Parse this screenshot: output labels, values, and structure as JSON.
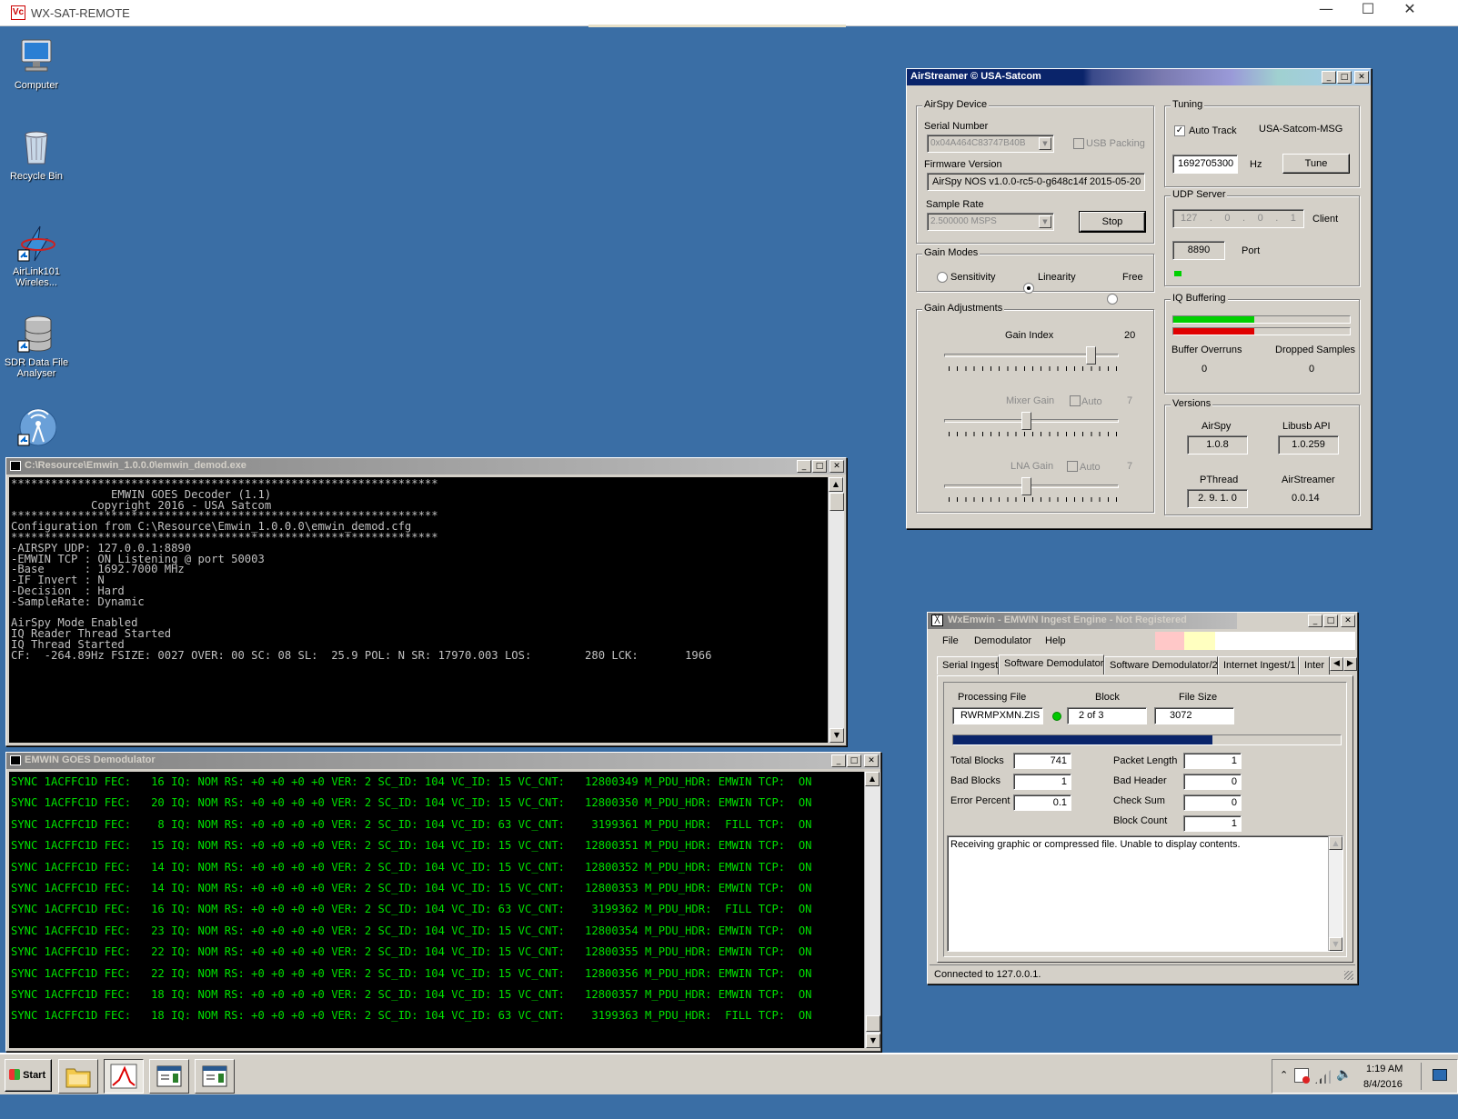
{
  "outer_window": {
    "title": "WX-SAT-REMOTE",
    "icon_text": "Vc"
  },
  "desktop_icons": [
    {
      "label": "Computer"
    },
    {
      "label": "Recycle Bin"
    },
    {
      "label": "AirLink101 Wireles..."
    },
    {
      "label": "SDR Data File Analyser"
    }
  ],
  "emwin_decoder": {
    "title": "C:\\Resource\\Emwin_1.0.0.0\\emwin_demod.exe",
    "lines": [
      "****************************************************************",
      "               EMWIN GOES Decoder (1.1)",
      "            Copyright 2016 - USA Satcom",
      "****************************************************************",
      "Configuration from C:\\Resource\\Emwin_1.0.0.0\\emwin_demod.cfg",
      "****************************************************************",
      "-AIRSPY UDP: 127.0.0.1:8890",
      "-EMWIN TCP : ON Listening @ port 50003",
      "-Base      : 1692.7000 MHz",
      "-IF Invert : N",
      "-Decision  : Hard",
      "-SampleRate: Dynamic",
      "",
      "AirSpy Mode Enabled",
      "IQ Reader Thread Started",
      "IQ Thread Started",
      "CF:  -264.89Hz FSIZE: 0027 OVER: 00 SC: 08 SL:  25.9 POL: N SR: 17970.003 LOS:        280 LCK:       1966"
    ]
  },
  "goes_demod": {
    "title": "EMWIN GOES Demodulator",
    "lines": [
      "SYNC 1ACFFC1D FEC:   16 IQ: NOM RS: +0 +0 +0 +0 VER: 2 SC_ID: 104 VC_ID: 15 VC_CNT:   12800349 M_PDU_HDR: EMWIN TCP:  ON",
      "SYNC 1ACFFC1D FEC:   20 IQ: NOM RS: +0 +0 +0 +0 VER: 2 SC_ID: 104 VC_ID: 15 VC_CNT:   12800350 M_PDU_HDR: EMWIN TCP:  ON",
      "SYNC 1ACFFC1D FEC:    8 IQ: NOM RS: +0 +0 +0 +0 VER: 2 SC_ID: 104 VC_ID: 63 VC_CNT:    3199361 M_PDU_HDR:  FILL TCP:  ON",
      "SYNC 1ACFFC1D FEC:   15 IQ: NOM RS: +0 +0 +0 +0 VER: 2 SC_ID: 104 VC_ID: 15 VC_CNT:   12800351 M_PDU_HDR: EMWIN TCP:  ON",
      "SYNC 1ACFFC1D FEC:   14 IQ: NOM RS: +0 +0 +0 +0 VER: 2 SC_ID: 104 VC_ID: 15 VC_CNT:   12800352 M_PDU_HDR: EMWIN TCP:  ON",
      "SYNC 1ACFFC1D FEC:   14 IQ: NOM RS: +0 +0 +0 +0 VER: 2 SC_ID: 104 VC_ID: 15 VC_CNT:   12800353 M_PDU_HDR: EMWIN TCP:  ON",
      "SYNC 1ACFFC1D FEC:   16 IQ: NOM RS: +0 +0 +0 +0 VER: 2 SC_ID: 104 VC_ID: 63 VC_CNT:    3199362 M_PDU_HDR:  FILL TCP:  ON",
      "SYNC 1ACFFC1D FEC:   23 IQ: NOM RS: +0 +0 +0 +0 VER: 2 SC_ID: 104 VC_ID: 15 VC_CNT:   12800354 M_PDU_HDR: EMWIN TCP:  ON",
      "SYNC 1ACFFC1D FEC:   22 IQ: NOM RS: +0 +0 +0 +0 VER: 2 SC_ID: 104 VC_ID: 15 VC_CNT:   12800355 M_PDU_HDR: EMWIN TCP:  ON",
      "SYNC 1ACFFC1D FEC:   22 IQ: NOM RS: +0 +0 +0 +0 VER: 2 SC_ID: 104 VC_ID: 15 VC_CNT:   12800356 M_PDU_HDR: EMWIN TCP:  ON",
      "SYNC 1ACFFC1D FEC:   18 IQ: NOM RS: +0 +0 +0 +0 VER: 2 SC_ID: 104 VC_ID: 15 VC_CNT:   12800357 M_PDU_HDR: EMWIN TCP:  ON",
      "SYNC 1ACFFC1D FEC:   18 IQ: NOM RS: +0 +0 +0 +0 VER: 2 SC_ID: 104 VC_ID: 63 VC_CNT:    3199363 M_PDU_HDR:  FILL TCP:  ON"
    ]
  },
  "airstreamer": {
    "title": "AirStreamer © USA-Satcom",
    "device": {
      "group": "AirSpy Device",
      "serial_label": "Serial Number",
      "serial_value": "0x04A464C83747B40B",
      "usb_packing": "USB Packing",
      "firmware_label": "Firmware Version",
      "firmware_value": "AirSpy NOS v1.0.0-rc5-0-g648c14f 2015-05-20",
      "sample_rate_label": "Sample Rate",
      "sample_rate_value": "2.500000 MSPS",
      "stop_button": "Stop"
    },
    "gain_modes": {
      "group": "Gain Modes",
      "options": [
        "Sensitivity",
        "Linearity",
        "Free"
      ],
      "selected": "Linearity"
    },
    "gain_adj": {
      "group": "Gain Adjustments",
      "gain_index_label": "Gain Index",
      "gain_index_value": "20",
      "mixer_label": "Mixer Gain",
      "mixer_value": "7",
      "lna_label": "LNA Gain",
      "lna_value": "7",
      "auto_label": "Auto",
      "gain_index_level": 0.86,
      "mixer_level": 0.47,
      "lna_level": 0.47
    },
    "tuning": {
      "group": "Tuning",
      "auto_track": "Auto Track",
      "preset": "USA-Satcom-MSG",
      "frequency": "1692705300",
      "unit": "Hz",
      "tune_button": "Tune"
    },
    "udp": {
      "group": "UDP Server",
      "ip_octets": [
        "127",
        "0",
        "0",
        "1"
      ],
      "client_label": "Client",
      "port_value": "8890",
      "port_label": "Port"
    },
    "iq": {
      "group": "IQ Buffering",
      "green_level": 0.46,
      "red_level": 0.46,
      "overruns_label": "Buffer Overruns",
      "overruns_value": "0",
      "dropped_label": "Dropped Samples",
      "dropped_value": "0"
    },
    "versions": {
      "group": "Versions",
      "airspy_label": "AirSpy",
      "airspy_value": "1.0.8",
      "libusb_label": "Libusb API",
      "libusb_value": "1.0.259",
      "pthread_label": "PThread",
      "pthread_value": "2. 9. 1. 0",
      "airstreamer_label": "AirStreamer",
      "airstreamer_value": "0.0.14"
    }
  },
  "wxemwin": {
    "title": "WxEmwin - EMWIN Ingest Engine - Not Registered",
    "menu": [
      "File",
      "Demodulator",
      "Help"
    ],
    "tabs": [
      "Serial Ingest",
      "Software Demodulator",
      "Software Demodulator/2",
      "Internet Ingest/1",
      "Inter"
    ],
    "active_tab": 1,
    "processing_file_label": "Processing File",
    "processing_file": "RWRMPXMN.ZIS",
    "block_label": "Block",
    "block": "2 of 3",
    "file_size_label": "File Size",
    "file_size": "3072",
    "progress": 0.67,
    "stats_left": [
      {
        "label": "Total Blocks",
        "value": "741"
      },
      {
        "label": "Bad Blocks",
        "value": "1"
      },
      {
        "label": "Error Percent",
        "value": "0.1"
      }
    ],
    "stats_right": [
      {
        "label": "Packet Length",
        "value": "1"
      },
      {
        "label": "Bad Header",
        "value": "0"
      },
      {
        "label": "Check Sum",
        "value": "0"
      },
      {
        "label": "Block Count",
        "value": "1"
      }
    ],
    "message": "Receiving graphic or compressed file. Unable to display contents.",
    "status": "Connected to 127.0.0.1."
  },
  "taskbar": {
    "start_label": "Start",
    "time": "1:19 AM",
    "date": "8/4/2016"
  },
  "colors": {
    "desktop": "#3a6ea5",
    "titlebar_active": "#0a246a",
    "console_green": "#00e000",
    "iq_green": "#00d000",
    "iq_red": "#e00000",
    "progress_blue": "#0a246a"
  }
}
